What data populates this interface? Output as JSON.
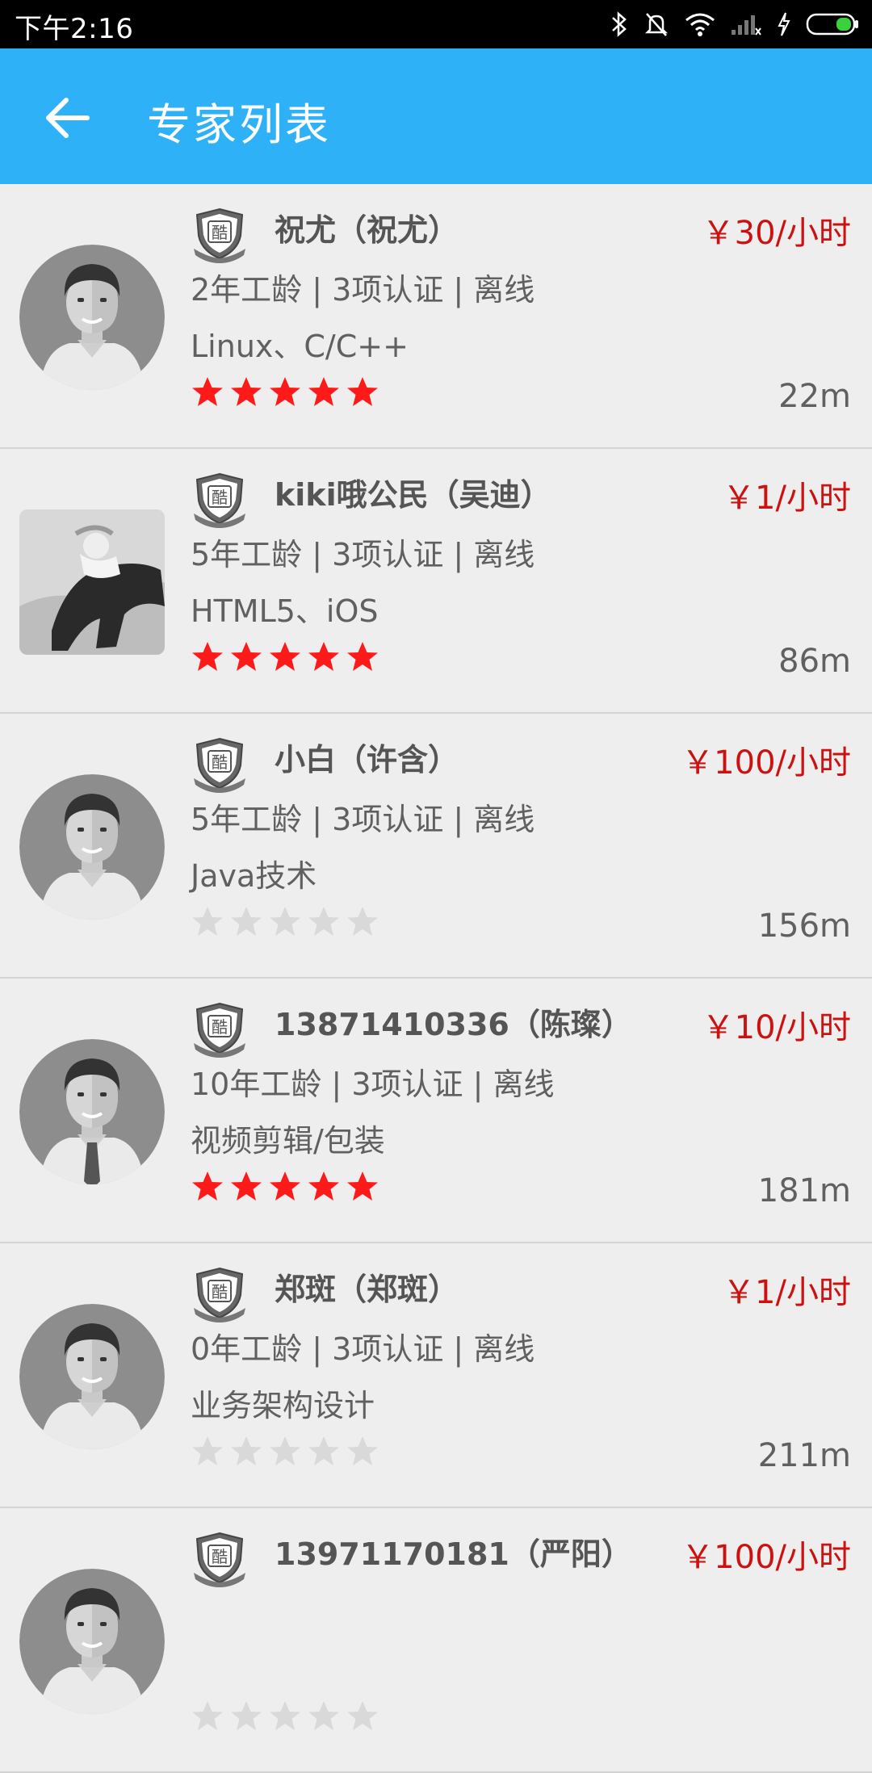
{
  "status_bar": {
    "time": "下午2:16",
    "icons": [
      "bluetooth-icon",
      "silent-bell-icon",
      "wifi-icon",
      "signal-icon",
      "charging-icon",
      "battery-icon"
    ]
  },
  "app_bar": {
    "title": "专家列表",
    "back_icon": "arrow-left-icon",
    "color": "#2fb1f8"
  },
  "colors": {
    "price": "#cc1111",
    "star_on": "#ff1a1a",
    "star_off": "#d9d9d9"
  },
  "experts": [
    {
      "name": "祝尤（祝尤）",
      "price": "￥30/小时",
      "meta": "2年工龄 | 3项认证 | 离线",
      "skills": "Linux、C/C++",
      "rating": 5,
      "distance": "22m",
      "avatar": "default-male"
    },
    {
      "name": "kiki哦公民（吴迪）",
      "price": "￥1/小时",
      "meta": "5年工龄 | 3项认证 | 离线",
      "skills": "HTML5、iOS",
      "rating": 5,
      "distance": "86m",
      "avatar": "photo"
    },
    {
      "name": "小白（许含）",
      "price": "￥100/小时",
      "meta": "5年工龄 | 3项认证 | 离线",
      "skills": "Java技术",
      "rating": 0,
      "distance": "156m",
      "avatar": "default-male"
    },
    {
      "name": "13871410336（陈璨）",
      "price": "￥10/小时",
      "meta": "10年工龄 | 3项认证 | 离线",
      "skills": "视频剪辑/包装",
      "rating": 5,
      "distance": "181m",
      "avatar": "business-male"
    },
    {
      "name": "郑斑（郑斑）",
      "price": "￥1/小时",
      "meta": "0年工龄 | 3项认证 | 离线",
      "skills": "业务架构设计",
      "rating": 0,
      "distance": "211m",
      "avatar": "default-male"
    },
    {
      "name": "13971170181（严阳）",
      "price": "￥100/小时",
      "meta": "",
      "skills": "",
      "rating": 0,
      "distance": "",
      "avatar": "default-male"
    }
  ]
}
